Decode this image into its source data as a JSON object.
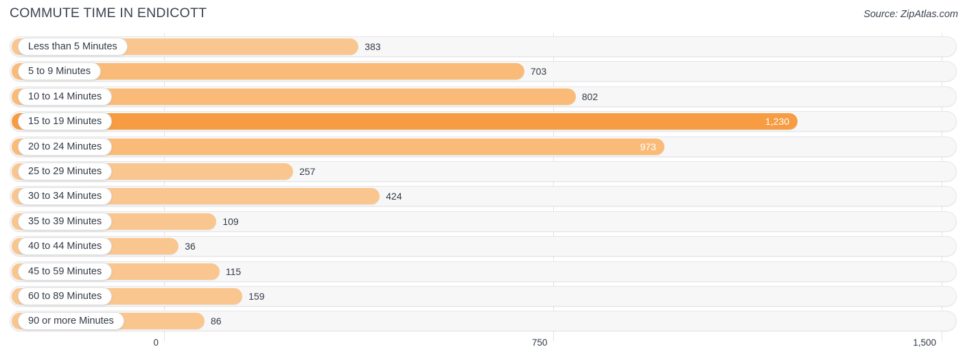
{
  "header": {
    "title": "COMMUTE TIME IN ENDICOTT",
    "source": "Source: ZipAtlas.com"
  },
  "colors": {
    "bar_light": "#fac68f",
    "bar_mid": "#fbbb78",
    "bar_strong": "#f79c42",
    "track": "#f7f7f8",
    "grid": "#e2e2e6",
    "text": "#333a46"
  },
  "chart_data": {
    "type": "bar",
    "orientation": "horizontal",
    "title": "COMMUTE TIME IN ENDICOTT",
    "xlabel": "",
    "ylabel": "",
    "xlim": [
      0,
      1500
    ],
    "grid": true,
    "legend": "none",
    "ticks": [
      "0",
      "750",
      "1,500"
    ],
    "tick_values": [
      0,
      750,
      1500
    ],
    "categories": [
      "Less than 5 Minutes",
      "5 to 9 Minutes",
      "10 to 14 Minutes",
      "15 to 19 Minutes",
      "20 to 24 Minutes",
      "25 to 29 Minutes",
      "30 to 34 Minutes",
      "35 to 39 Minutes",
      "40 to 44 Minutes",
      "45 to 59 Minutes",
      "60 to 89 Minutes",
      "90 or more Minutes"
    ],
    "values": [
      383,
      703,
      802,
      1230,
      973,
      257,
      424,
      109,
      36,
      115,
      159,
      86
    ],
    "value_labels": [
      "383",
      "703",
      "802",
      "1,230",
      "973",
      "257",
      "424",
      "109",
      "36",
      "115",
      "159",
      "86"
    ]
  },
  "rows": [
    {
      "label": "Less than 5 Minutes",
      "value": 383,
      "value_label": "383",
      "inside": false,
      "shade": "light"
    },
    {
      "label": "5 to 9 Minutes",
      "value": 703,
      "value_label": "703",
      "inside": false,
      "shade": "mid"
    },
    {
      "label": "10 to 14 Minutes",
      "value": 802,
      "value_label": "802",
      "inside": false,
      "shade": "mid"
    },
    {
      "label": "15 to 19 Minutes",
      "value": 1230,
      "value_label": "1,230",
      "inside": true,
      "shade": "strong"
    },
    {
      "label": "20 to 24 Minutes",
      "value": 973,
      "value_label": "973",
      "inside": true,
      "shade": "mid"
    },
    {
      "label": "25 to 29 Minutes",
      "value": 257,
      "value_label": "257",
      "inside": false,
      "shade": "light"
    },
    {
      "label": "30 to 34 Minutes",
      "value": 424,
      "value_label": "424",
      "inside": false,
      "shade": "light"
    },
    {
      "label": "35 to 39 Minutes",
      "value": 109,
      "value_label": "109",
      "inside": false,
      "shade": "light"
    },
    {
      "label": "40 to 44 Minutes",
      "value": 36,
      "value_label": "36",
      "inside": false,
      "shade": "light"
    },
    {
      "label": "45 to 59 Minutes",
      "value": 115,
      "value_label": "115",
      "inside": false,
      "shade": "light"
    },
    {
      "label": "60 to 89 Minutes",
      "value": 159,
      "value_label": "159",
      "inside": false,
      "shade": "light"
    },
    {
      "label": "90 or more Minutes",
      "value": 86,
      "value_label": "86",
      "inside": false,
      "shade": "light"
    }
  ]
}
